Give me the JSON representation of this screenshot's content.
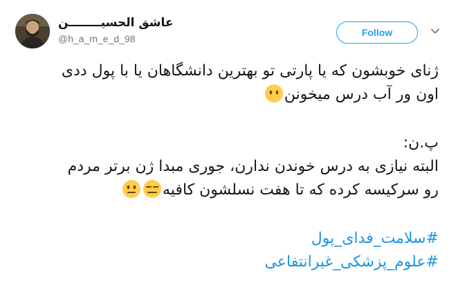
{
  "tweet": {
    "author": {
      "display_name": "عاشق الحسیــــــــن",
      "handle": "@h_a_m_e_d_98",
      "avatar_icon": "profile-photo-icon"
    },
    "follow_label": "Follow",
    "menu_icon": "chevron-down-icon",
    "lines": {
      "l1": "ژنای خوبشون که یا پارتی تو بهترین دانشگاهان یا با پول ددی",
      "l2": "اون ور آب درس میخونن",
      "l3": "پ.ن:",
      "l4": "البته نیازی به درس خوندن ندارن، جوری مبدا ژن برتر مردم",
      "l5": "رو سرکیسه کرده که تا هفت نسلشون کافیه"
    },
    "hashtags": [
      "#سلامت_فدای_پول",
      "#علوم_پزشکی_غیرانتفاعی"
    ],
    "emojis": {
      "e1": "face-without-mouth-icon",
      "e2": "expressionless-face-icon",
      "e3": "neutral-face-icon"
    }
  },
  "colors": {
    "accent": "#1da1f2",
    "hashtag": "#1b95e0",
    "text": "#14171a",
    "muted": "#657786",
    "emoji": "#ffcc4d"
  }
}
